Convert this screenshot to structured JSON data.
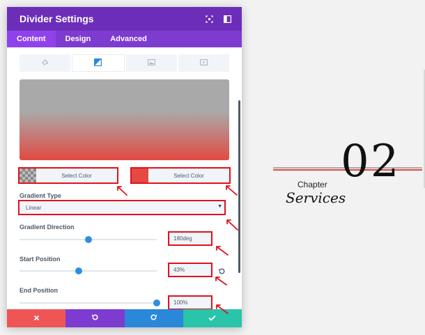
{
  "modal": {
    "title": "Divider Settings",
    "header_icons": [
      "focus-icon",
      "sidebar-toggle-icon"
    ],
    "tabs": [
      {
        "label": "Content",
        "active": true
      },
      {
        "label": "Design",
        "active": false
      },
      {
        "label": "Advanced",
        "active": false
      }
    ],
    "background_types": [
      "color-icon",
      "gradient-icon",
      "image-icon",
      "video-icon"
    ],
    "active_background_type": "gradient",
    "gradient_preview": {
      "start_color": "#a9a9a9",
      "end_color": "#e24a42"
    },
    "color_pickers": [
      {
        "label": "Select Color",
        "swatch": "transparent"
      },
      {
        "label": "Select Color",
        "swatch": "#e44a42"
      }
    ],
    "gradient_type": {
      "label": "Gradient Type",
      "value": "Linear"
    },
    "gradient_direction": {
      "label": "Gradient Direction",
      "value": "180deg",
      "slider_fraction": 0.5
    },
    "start_position": {
      "label": "Start Position",
      "value": "43%",
      "slider_fraction": 0.43
    },
    "end_position": {
      "label": "End Position",
      "value": "100%",
      "slider_fraction": 1.0
    },
    "footer_buttons": [
      "close-icon",
      "undo-icon",
      "redo-icon",
      "check-icon"
    ],
    "colors": {
      "header": "#6c2eb9",
      "tabs": "#7e3bd0",
      "annotation": "#e3101c"
    }
  },
  "preview": {
    "number": "02",
    "chapter": "Chapter",
    "title": "Services",
    "line_colors": [
      "#a9a9a9",
      "#e44a42"
    ]
  }
}
